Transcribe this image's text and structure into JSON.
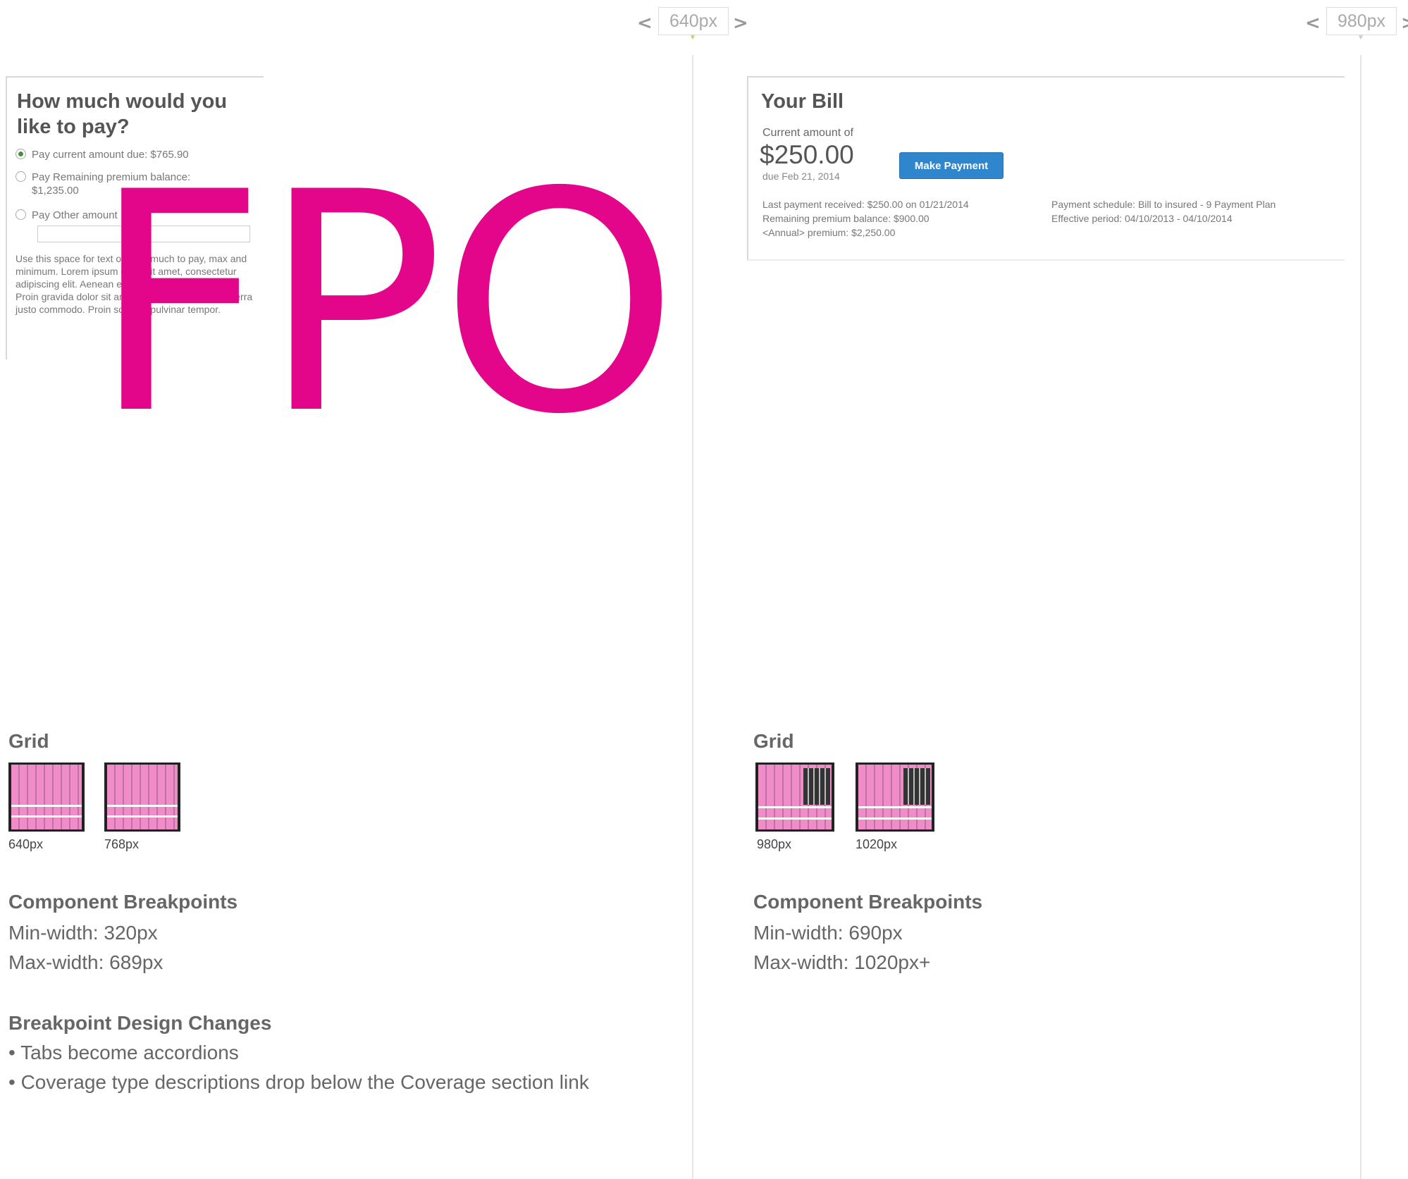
{
  "breakpoints": {
    "left": {
      "label": "640px",
      "prev": "<",
      "next": ">"
    },
    "right": {
      "label": "980px",
      "prev": "<",
      "next": ">"
    }
  },
  "pay_card": {
    "title": "How much would you like to pay?",
    "options": [
      {
        "label": "Pay current amount due: $765.90",
        "selected": true
      },
      {
        "label": "Pay Remaining premium balance: $1,235.00",
        "selected": false
      },
      {
        "label": "Pay Other amount",
        "selected": false
      }
    ],
    "description": "Use this space for text on how much to pay, max and minimum. Lorem ipsum dolor sit amet, consectetur adipiscing elit. Aenean euismod bibendum laoreet. Proin gravida dolor sit amet lacus accumsan et viverra justo commodo. Proin sodales pulvinar tempor."
  },
  "fpo": "FPO",
  "bill_card": {
    "title": "Your Bill",
    "current_label": "Current amount of",
    "amount": "$250.00",
    "due": "due Feb 21, 2014",
    "button": "Make Payment",
    "info_left": [
      "Last payment received: $250.00 on 01/21/2014",
      "Remaining premium balance: $900.00",
      "<Annual> premium: $2,250.00"
    ],
    "info_right": [
      "Payment schedule: Bill to insured - 9 Payment Plan",
      "Effective period: 04/10/2013 - 04/10/2014"
    ]
  },
  "left_section": {
    "grid_heading": "Grid",
    "thumbs": [
      "640px",
      "768px"
    ],
    "breakpoints_heading": "Component Breakpoints",
    "min": "Min-width: 320px",
    "max": "Max-width: 689px",
    "changes_heading": "Breakpoint Design Changes",
    "changes": [
      "• Tabs become accordions",
      "• Coverage type descriptions drop below the Coverage section link"
    ]
  },
  "right_section": {
    "grid_heading": "Grid",
    "thumbs": [
      "980px",
      "1020px"
    ],
    "breakpoints_heading": "Component Breakpoints",
    "min": "Min-width: 690px",
    "max": "Max-width: 1020px+"
  }
}
